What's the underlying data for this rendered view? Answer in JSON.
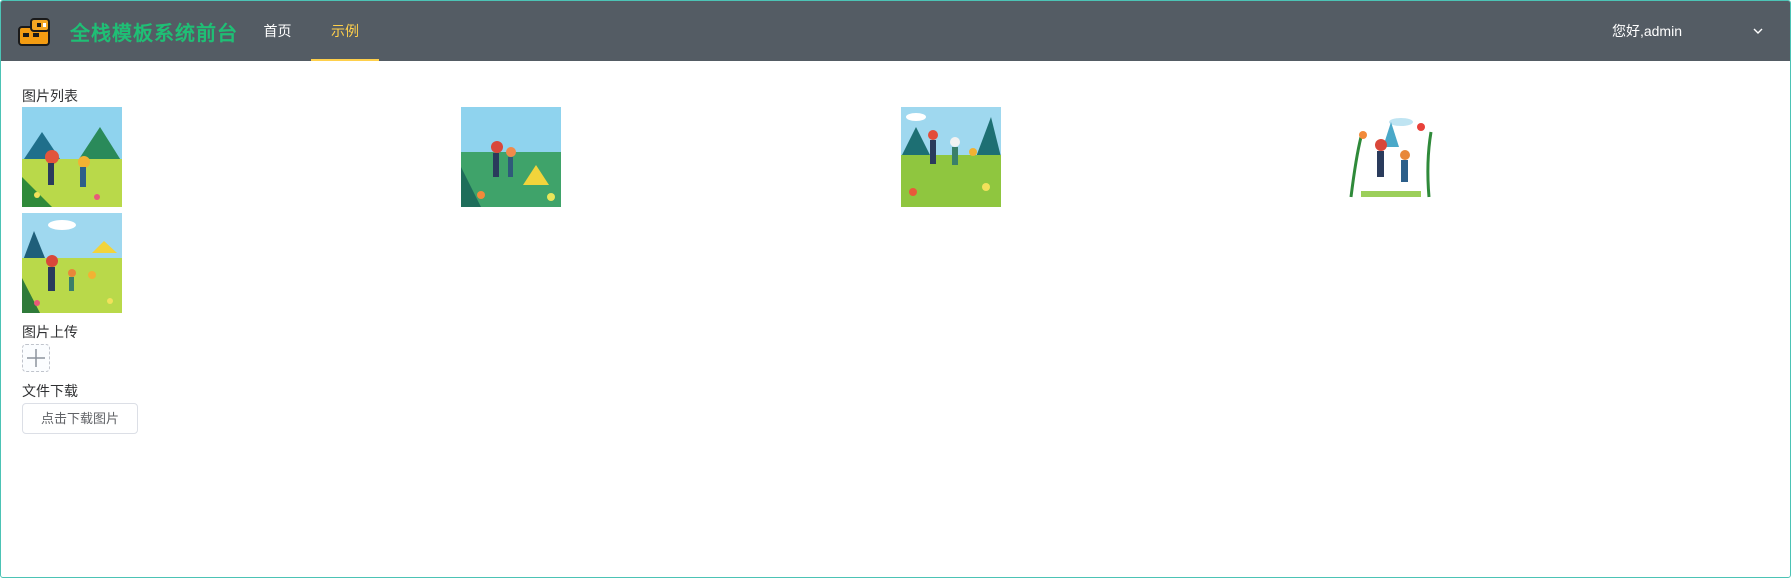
{
  "header": {
    "brand": "全栈模板系统前台",
    "nav": [
      {
        "label": "首页",
        "active": false
      },
      {
        "label": "示例",
        "active": true
      }
    ],
    "user_greeting": "您好,admin",
    "colors": {
      "background": "#545c64",
      "brand": "#1fbf75",
      "active": "#ffd04b",
      "text": "#ffffff"
    }
  },
  "main": {
    "image_list_label": "图片列表",
    "images": [
      {
        "icon": "hiking-illustration-1"
      },
      {
        "icon": "hiking-illustration-2"
      },
      {
        "icon": "hiking-illustration-3"
      },
      {
        "icon": "hiking-illustration-4"
      },
      {
        "icon": "hiking-illustration-5"
      }
    ],
    "upload_label": "图片上传",
    "upload_icon": "plus-icon",
    "download_label": "文件下载",
    "download_button": "点击下载图片"
  }
}
